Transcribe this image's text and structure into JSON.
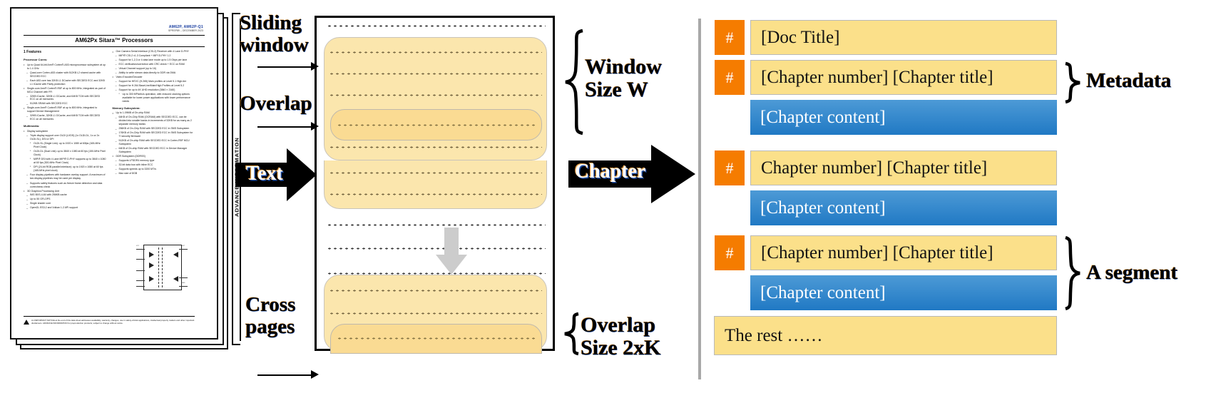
{
  "document_page": {
    "part_numbers": "AM62P, AM62P-Q1",
    "doc_code": "SPRSP89 – DECEMBER 2023",
    "title": "AM62Px Sitara™ Processors",
    "side_band": "ADVANCE INFORMATION",
    "left_column": {
      "section_heading": "1 Features",
      "sub_heading": "Processor Cores:",
      "bullets": [
        "Up to Quad 64-bit Arm® Cortex®-A53 microprocessor subsystem at up to 1.4 GHz",
        "Single-core Arm® Cortex®-R5F at up to 800 MHz, integrated as part of MCU Channel with FFI",
        "Single-core Arm® Cortex®-R5F at up to 800 MHz, integrated to support Device Management"
      ],
      "dashes_1": [
        "Quad-core Cortex-A53 cluster with 512KB L2 shared cache with SECDED ECC",
        "Each A53 core has 32KB L1 DCache with SECDED ECC and 32KB L1 ICache with Parity protection"
      ],
      "dashes_2": [
        "32KB ICache, 32KB L1 DCache, and 64KB TCM with SECDED ECC on all memories",
        "512KB SRAM with SECDED ECC"
      ],
      "dashes_3": [
        "32KB ICache, 32KB L1 DCache, and 64KB TCM with SECDED ECC on all memories"
      ],
      "multimedia_heading": "Multimedia:",
      "multimedia": [
        "Display subsystem",
        "3D Graphics Processing Unit"
      ],
      "display_dashes": [
        "Triple display support over OLDI (LVDS) (1x OLDI-DL, 1x or 2x OLDI-SL), DSI or DPI",
        "Four display pipelines with hardware overlay support. A maximum of two display pipelines may be used per display.",
        "Supports safety features such as freeze frame detection and data correctness check"
      ],
      "display_squares": [
        "OLDI-SL (Single Link): up to 1920 x 1080 at 60fps (165-MHz Pixel Clock)",
        "OLDI-DL (Dual Link): up to 3840 x 1080 at 60 fps (150-MHz Pixel Clock)",
        "MIPI® DSI with 4 Lane MIPI® D-PHY supports up to 3840 x 1080 at 60 fps (300-MHz Pixel Clock)",
        "DPI (24-bit RGB parallel interface): up to 1920 x 1080 at 60 fps (165-MHz pixel clock)"
      ],
      "gpu_dashes": [
        "IMG BXS-4-64 with 256KB cache",
        "Up to 50 GFLOPS",
        "Single shader core",
        "OpenGL ES3.2 and Vulkan 1.2 API support"
      ]
    },
    "right_column": {
      "bullets": [
        "One Camera Serial Interface (CSI-2) Receiver with 4 Lane D-PHY",
        "Video Encoder/Decoder"
      ],
      "csi_dashes": [
        "MIPI® CSI-2 v1.3 Compliant + MIPI D-PHY 1.2",
        "Support for 1,2,3 or 4 data lane mode up to 1.5 Gbps per lane",
        "ECC verification/correction with CRC check + ECC on RAM",
        "Virtual Channel support (up to 16)",
        "Ability to write stream data directly to DDR via DMA"
      ],
      "video_dashes": [
        "Support for HEVC (H.265) Main profiles at Level 5.1 High-tier",
        "Support for H.264 BaseLine/Main/High Profiles at Level 5.2",
        "Support for up to 4K UHD resolution (3840 × 2160)"
      ],
      "video_squares": [
        "Up to 300 MPixels/s operation, with reduced clocking options available for lower power applications with lower performance needs"
      ],
      "memory_heading": "Memory Subsystem:",
      "memory_bullets": [
        "Up to 1.09MB of On-chip RAM",
        "DDR Subsystem (DDRSS)"
      ],
      "memory_dashes": [
        "64KB of On-Chip RAM (OCRAM) with SECDED ECC, can be divided into smaller banks in increments of 32KB for as many as 2 separate memory banks",
        "256KB of On-Chip RAM with SECDED ECC in SMS Subsystem",
        "176KB of On-Chip RAM with SECDED ECC in SMS Subsystem for TI security firmware",
        "512KB of On-chip RAM with SECDED ECC in Cortex-R5F MCU Subsystem",
        "64KB of On-chip RAM with SECDED ECC in Device Manager Subsystem"
      ],
      "ddr_dashes": [
        "Supports LPDDR4 memory type",
        "32-bit data bus with inline ECC",
        "Supports speeds up to 3200 MT/s",
        "Max size of 8GB"
      ]
    },
    "footer_notice": "An IMPORTANT NOTICE at the end of this data sheet addresses availability, warranty, changes, use in safety-critical applications, intellectual property matters and other important disclaimers. ADVANCE INFORMATION for preproduction products; subject to change without notice."
  },
  "labels": {
    "sliding_window": "Sliding\nwindow",
    "sliding_window_l1": "Sliding",
    "sliding_window_l2": "window",
    "overlap": "Overlap",
    "cross_pages_l1": "Cross",
    "cross_pages_l2": "pages",
    "window_size_l1": "Window",
    "window_size_l2": "Size W",
    "overlap_size_l1": "Overlap",
    "overlap_size_l2": "Size 2xK",
    "metadata": "Metadata",
    "a_segment": "A segment"
  },
  "flow_arrows": {
    "text": "Text",
    "chapter": "Chapter"
  },
  "chunk_panel": {
    "rows": [
      {
        "type": "heading",
        "chip": "#",
        "text": "[Doc Title]"
      },
      {
        "type": "heading",
        "chip": "#",
        "text": "[Chapter number] [Chapter title]"
      },
      {
        "type": "content",
        "text": "[Chapter content]"
      },
      {
        "type": "heading",
        "chip": "#",
        "text": "Chapter number] [Chapter title]"
      },
      {
        "type": "content",
        "text": "[Chapter content]"
      },
      {
        "type": "heading",
        "chip": "#",
        "text": "[Chapter number] [Chapter title]"
      },
      {
        "type": "content",
        "text": "[Chapter content]"
      },
      {
        "type": "rest",
        "text": "The rest ……"
      }
    ]
  },
  "colors": {
    "chip_orange": "#f57c00",
    "heading_yellow": "#fbe08a",
    "content_blue": "#2079c4",
    "window_fill": "#fbe6ad",
    "overlap_fill": "#fadb93",
    "separator_gray": "#a8a8a8"
  }
}
